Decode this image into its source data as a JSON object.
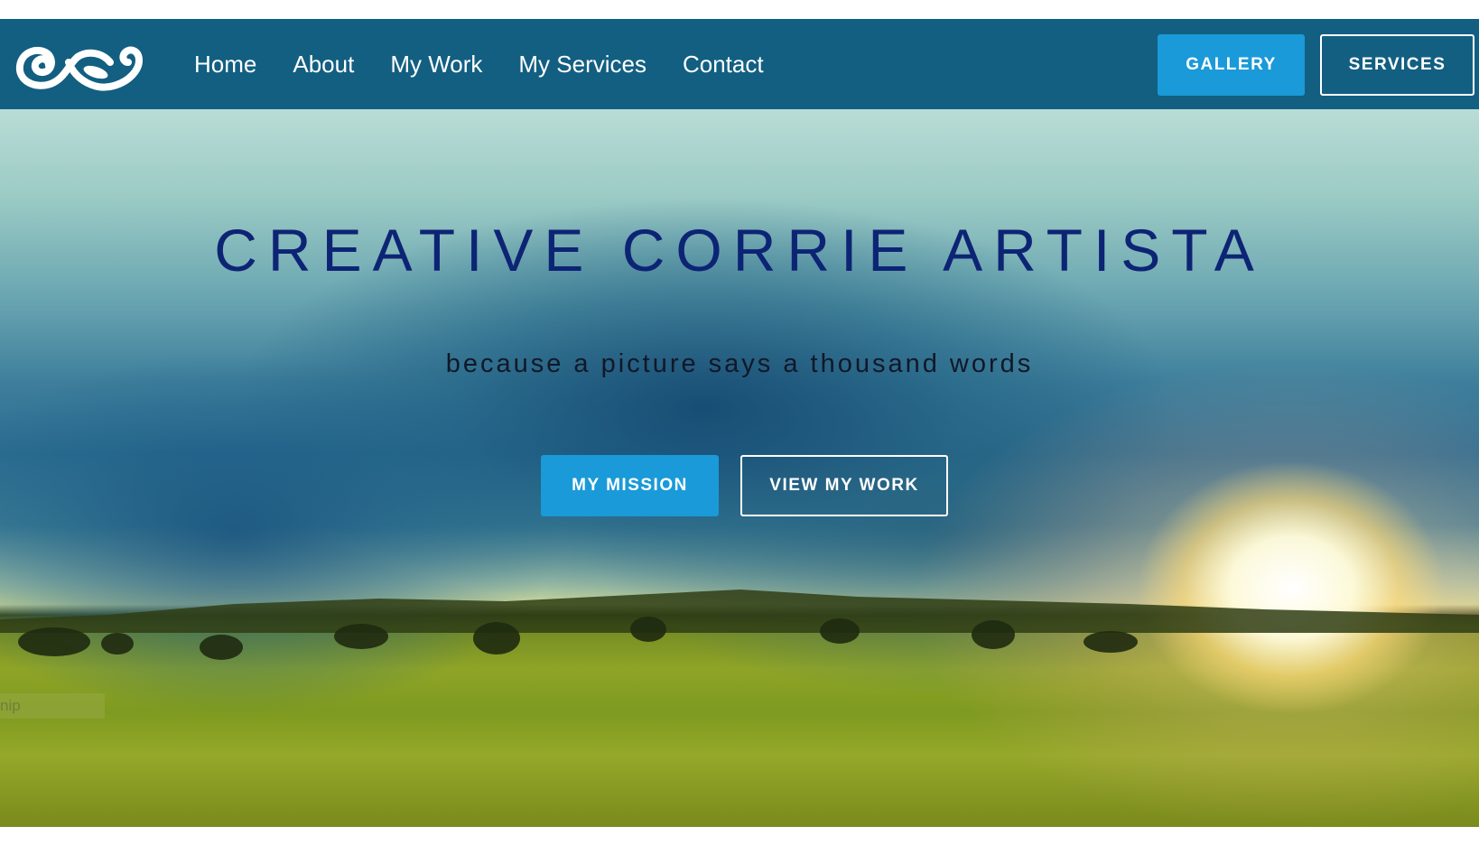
{
  "header": {
    "logo_icon": "swirl-logo-icon",
    "nav": {
      "items": [
        "Home",
        "About",
        "My Work",
        "My Services",
        "Contact"
      ]
    },
    "buttons": {
      "gallery": "GALLERY",
      "services": "SERVICES"
    }
  },
  "hero": {
    "title": "CREATIVE CORRIE ARTISTA",
    "subtitle": "because a picture says a thousand words",
    "buttons": {
      "mission": "MY MISSION",
      "work": "VIEW MY WORK"
    },
    "tooltip_text": "nip"
  },
  "colors": {
    "navbar": "#125f82",
    "accent": "#1a9ad8",
    "title": "#0d2475"
  }
}
